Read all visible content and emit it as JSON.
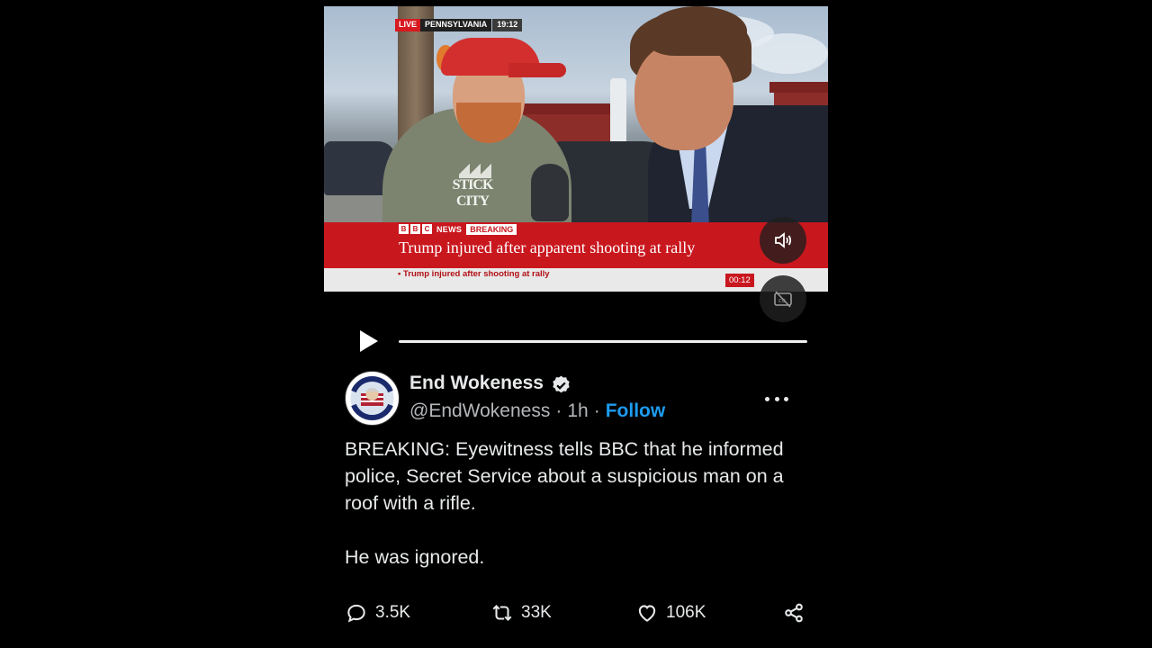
{
  "video": {
    "live_label": "LIVE",
    "location": "PENNSYLVANIA",
    "broadcast_time": "19:12",
    "channel_letters": [
      "B",
      "B",
      "C"
    ],
    "channel_name": "NEWS",
    "breaking_label": "BREAKING",
    "headline": "Trump injured after apparent shooting at rally",
    "ticker": "Trump injured after shooting at rally",
    "clip_timer": "00:12",
    "shirt_text": "STICK CITY",
    "sound_button_icon": "volume-icon",
    "captions_button_icon": "captions-off-icon"
  },
  "player": {
    "play_icon": "play-icon",
    "progress_fraction": 0.0
  },
  "tweet": {
    "author_name": "End Wokeness",
    "verified": true,
    "handle": "@EndWokeness",
    "separator": "·",
    "time_ago": "1h",
    "follow_label": "Follow",
    "text_paragraphs": [
      "BREAKING: Eyewitness tells BBC that he informed police, Secret Service about a suspicious man on a roof with a rifle.",
      "He was ignored."
    ],
    "stats": {
      "replies": "3.5K",
      "reposts": "33K",
      "likes": "106K"
    }
  },
  "colors": {
    "background": "#000000",
    "accent": "#1d9bf0",
    "bbc_red": "#c9171e",
    "text": "#e7e9ea",
    "muted": "#b4b7ba"
  }
}
